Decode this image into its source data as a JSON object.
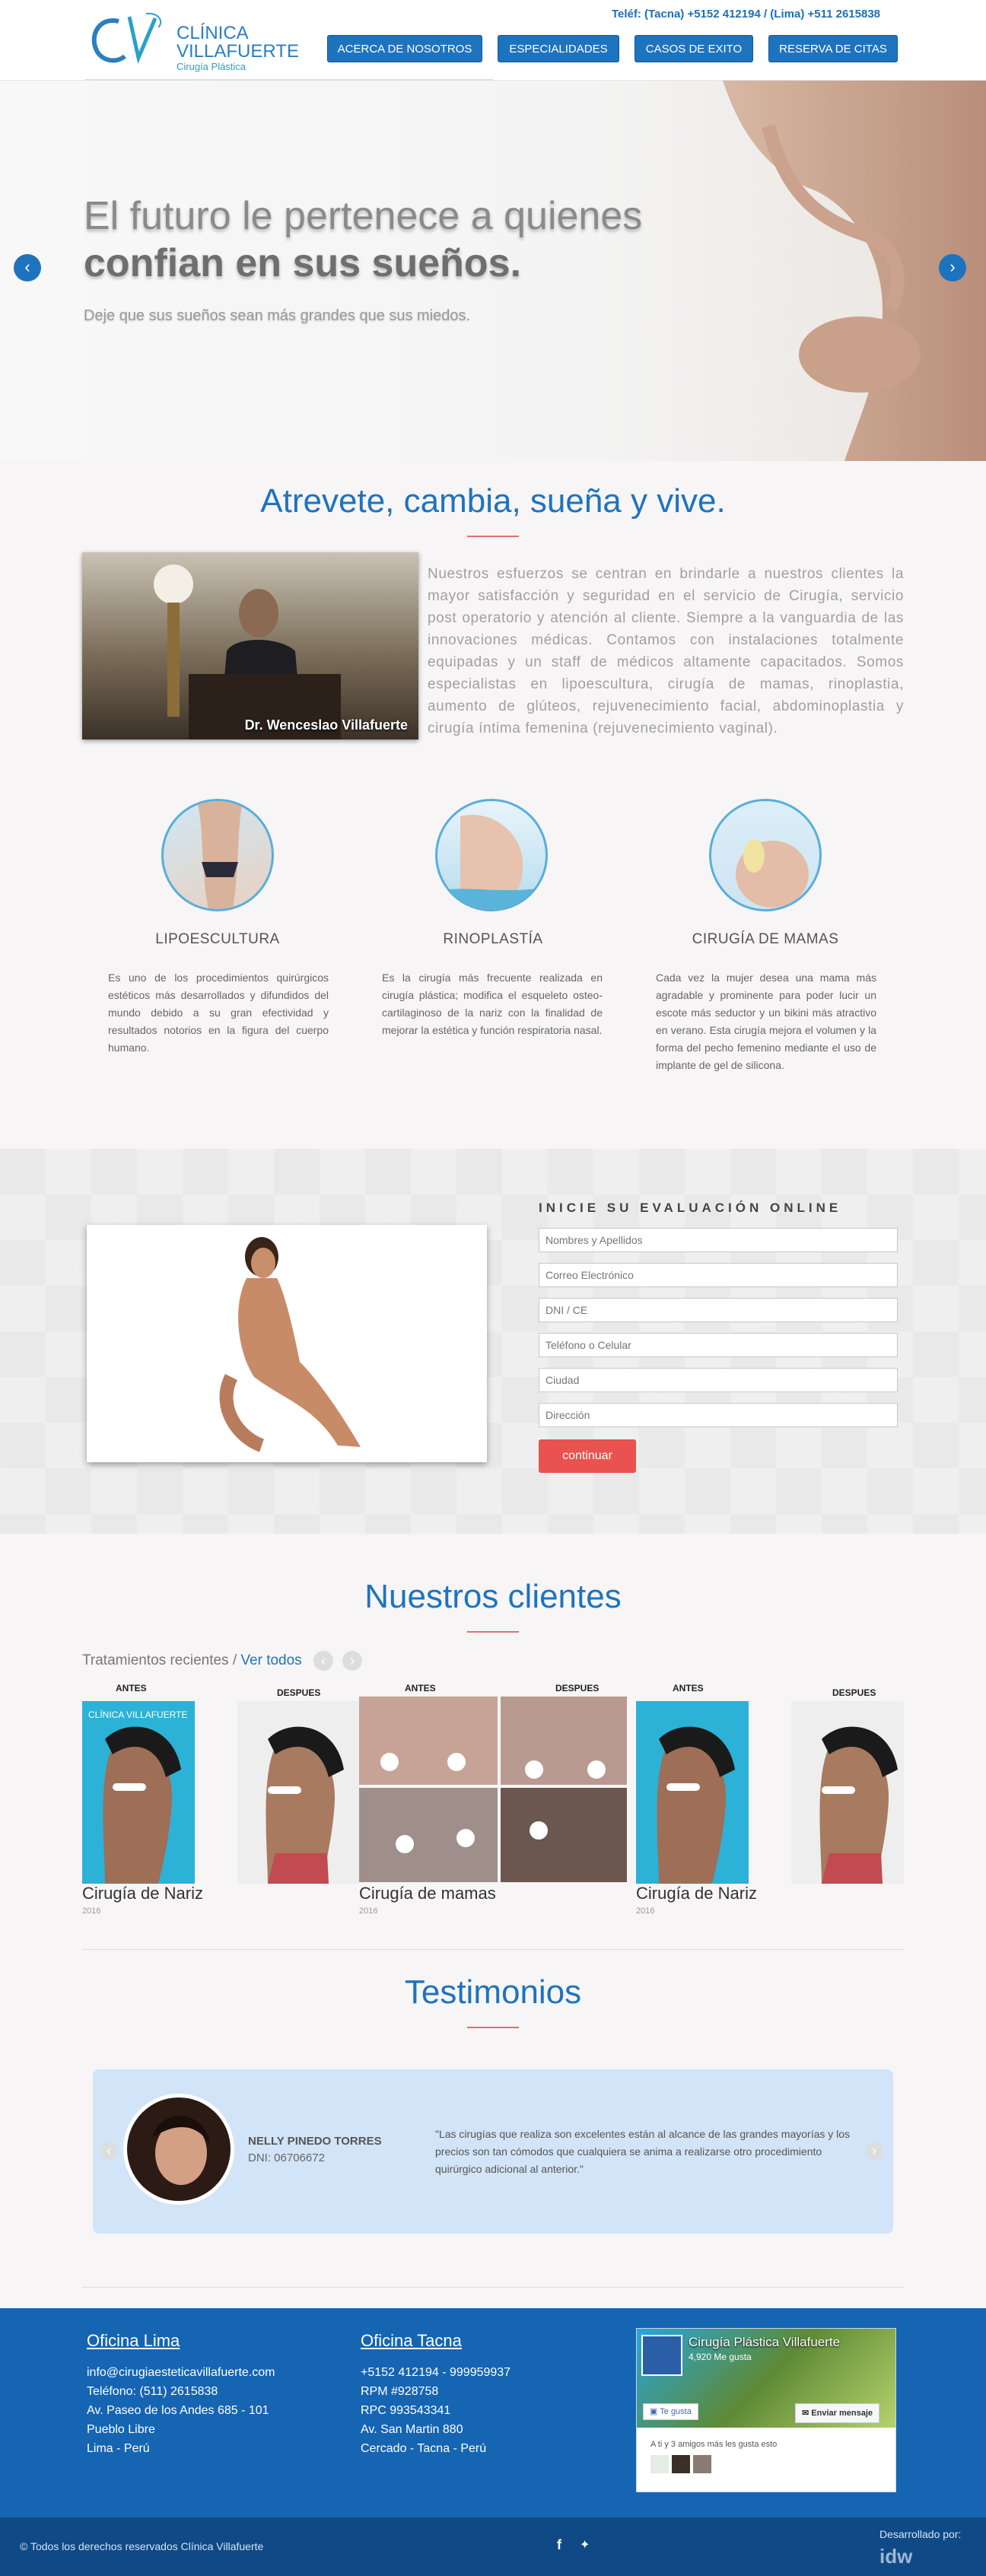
{
  "header": {
    "logo_text_1": "CLÍNICA",
    "logo_text_2": "VILLAFUERTE",
    "logo_sub": "Cirugía Plástica",
    "phone": "Teléf: (Tacna) +5152 412194 / (Lima) +511 2615838",
    "nav": [
      "ACERCA DE NOSOTROS",
      "ESPECIALIDADES",
      "CASOS DE EXITO",
      "RESERVA DE CITAS"
    ]
  },
  "hero": {
    "line1": "El futuro le pertenece a quienes",
    "line2": "confian en sus sueños.",
    "tagline": "Deje que sus sueños sean más grandes que sus miedos.",
    "prev_icon": "chevron-left-icon",
    "next_icon": "chevron-right-icon"
  },
  "about": {
    "title": "Atrevete, cambia, sueña y vive.",
    "doctor_caption": "Dr. Wenceslao Villafuerte",
    "text": "Nuestros esfuerzos se centran en brindarle a nuestros clientes la mayor satisfacción y seguridad en el servicio de Cirugía, servicio post operatorio y atención al cliente. Siempre a la vanguardia de las innovaciones médicas. Contamos con instalaciones totalmente equipadas y un staff de médicos altamente capacitados. Somos especialistas en lipoescultura, cirugía de mamas, rinoplastia, aumento de glúteos, rejuvenecimiento facial, abdominoplastia y cirugía íntima femenina (rejuvenecimiento vaginal)."
  },
  "services": [
    {
      "title": "LIPOESCULTURA",
      "text": "Es uno de los procedimientos quirúrgicos estéticos más desarrollados y difundidos del mundo debido a su gran efectividad y resultados notorios en la figura del cuerpo humano."
    },
    {
      "title": "RINOPLASTÍA",
      "text": "Es la cirugía más frecuente realizada en cirugía plástica; modifica el esqueleto osteo-cartilaginoso de la nariz con la finalidad de mejorar la estética y función respiratoria nasal."
    },
    {
      "title": "CIRUGÍA DE MAMAS",
      "text": "Cada vez la mujer desea una mama más agradable y prominente para poder lucir un escote más seductor y un bikini más atractivo en verano. Esta cirugía mejora el volumen y la forma del pecho femenino mediante el uso de implante de gel de silicona."
    }
  ],
  "form": {
    "title": "INICIE SU EVALUACIÓN ONLINE",
    "fields": [
      "Nombres y Apellidos",
      "Correo Electrónico",
      "DNI / CE",
      "Teléfono o Celular",
      "Ciudad",
      "Dirección"
    ],
    "submit": "continuar"
  },
  "clients": {
    "title": "Nuestros clientes",
    "recent": "Tratamientos recientes /",
    "view_all": "Ver todos",
    "before": "ANTES",
    "after": "DESPUES",
    "cases": [
      {
        "title": "Cirugía de Nariz",
        "year": "2016"
      },
      {
        "title": "Cirugía de mamas",
        "year": "2016"
      },
      {
        "title": "Cirugía de Nariz",
        "year": "2016"
      }
    ],
    "watermark": "CLÍNICA VILLAFUERTE"
  },
  "testimonials": {
    "title": "Testimonios",
    "name": "NELLY PINEDO TORRES",
    "dni": "DNI: 06706672",
    "quote": "\"Las cirugías que realiza son excelentes están al alcance de las grandes mayorías y los precios son tan cómodos que cualquiera se anima a realizarse otro procedimiento quirúrgico adicional al anterior.\""
  },
  "footer": {
    "lima_title": "Oficina Lima",
    "lima_lines": [
      "info@cirugiaesteticavillafuerte.com",
      "Teléfono: (511) 2615838",
      "Av. Paseo de los Andes 685 - 101",
      "Pueblo Libre",
      "Lima - Perú"
    ],
    "tacna_title": "Oficina Tacna",
    "tacna_lines": [
      "+5152 412194 - 999959937",
      "RPM #928758",
      "RPC 993543341",
      "Av. San Martin 880",
      "Cercado - Tacna - Perú"
    ],
    "fb_name": "Cirugía Plástica Villafuerte",
    "fb_likes": "4,920 Me gusta",
    "fb_like_btn": "Te gusta",
    "fb_msg_btn": "Enviar mensaje",
    "fb_friends": "A ti y 3 amigos más les gusta esto",
    "copyright": "© Todos los derechos reservados Clínica Villafuerte",
    "dev_label": "Desarrollado por:",
    "dev_logo": "idw"
  },
  "colors": {
    "primary": "#1e73be",
    "accent": "#e9524f",
    "footer": "#1565b3",
    "footer_bottom": "#0f4a87"
  }
}
